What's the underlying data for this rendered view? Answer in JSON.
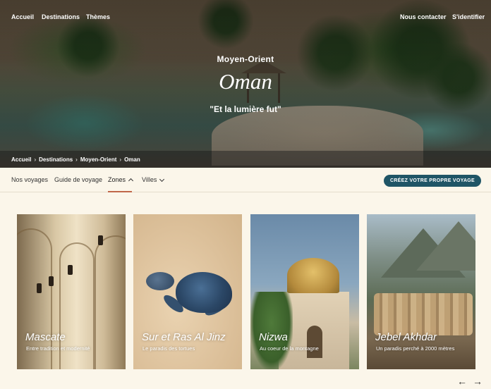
{
  "topnav": {
    "left": [
      "Accueil",
      "Destinations",
      "Thèmes"
    ],
    "contact": "Nous contacter",
    "login": "S'identifier"
  },
  "hero": {
    "region": "Moyen-Orient",
    "title": "Oman",
    "quote": "\"Et la lumière fut\""
  },
  "breadcrumb": [
    "Accueil",
    "Destinations",
    "Moyen-Orient",
    "Oman"
  ],
  "subnav": {
    "items": [
      "Nos voyages",
      "Guide de voyage",
      "Zones",
      "Villes"
    ],
    "active": "Zones",
    "cta": "CRÉEZ VOTRE PROPRE VOYAGE"
  },
  "cards": [
    {
      "title": "Mascate",
      "subtitle": "Entre tradition et modernité"
    },
    {
      "title": "Sur et Ras Al Jinz",
      "subtitle": "Le paradis des tortues"
    },
    {
      "title": "Nizwa",
      "subtitle": "Au coeur de la montagne"
    },
    {
      "title": "Jebel Akhdar",
      "subtitle": "Un paradis perché à 2000 mètres"
    }
  ],
  "carousel": {
    "prev_icon": "arrow-left-icon",
    "next_icon": "arrow-right-icon"
  },
  "colors": {
    "cta": "#1f5566",
    "active_underline": "#c0674a",
    "background": "#fbf6ea"
  }
}
